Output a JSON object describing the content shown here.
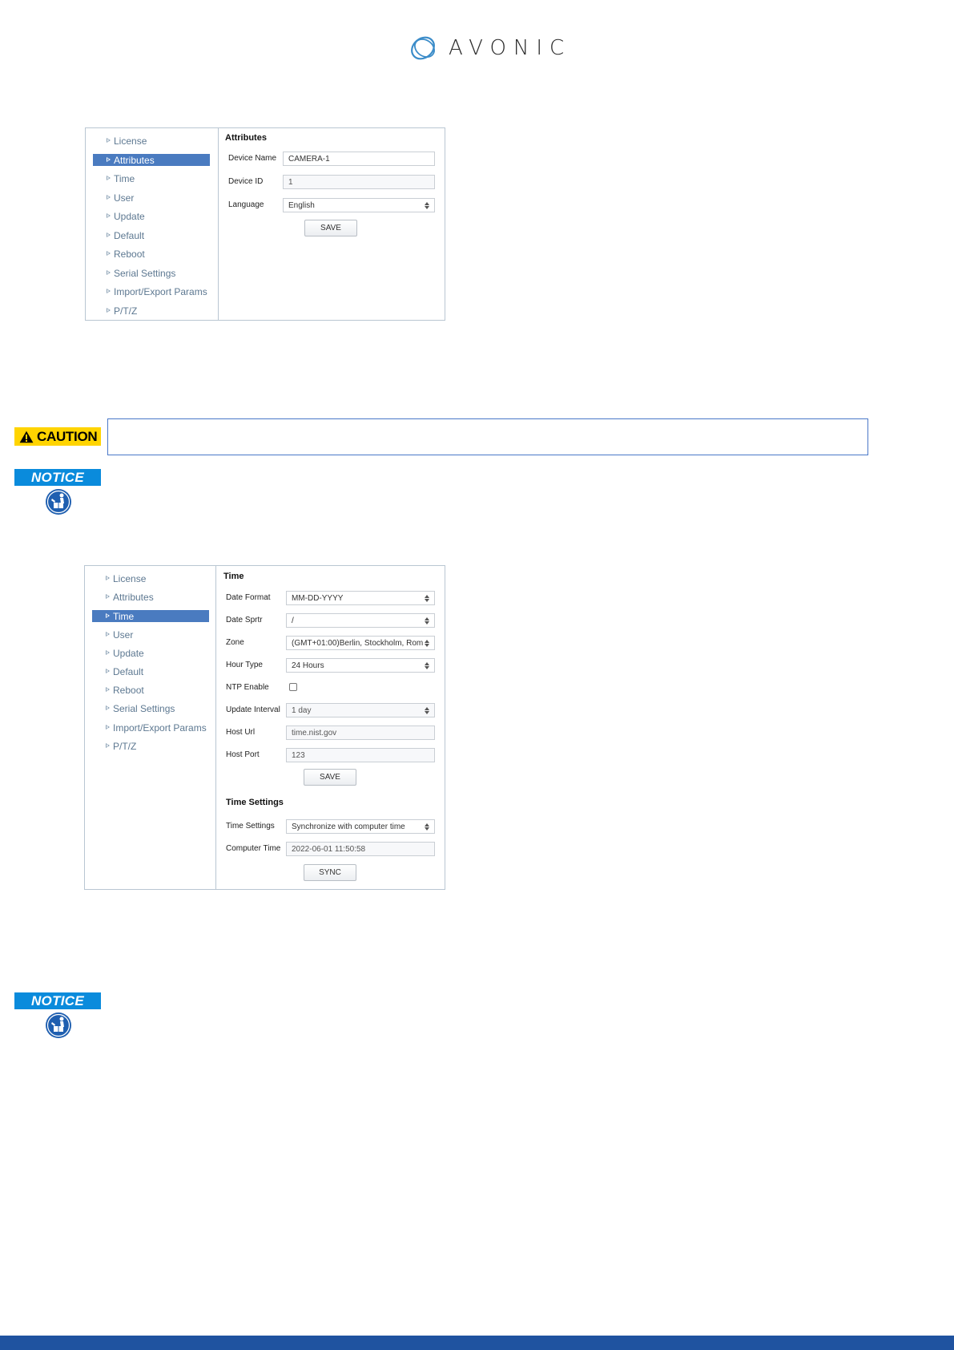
{
  "brand": {
    "name": "AVONIC"
  },
  "panel1": {
    "nav": [
      "License",
      "Attributes",
      "Time",
      "User",
      "Update",
      "Default",
      "Reboot",
      "Serial Settings",
      "Import/Export Params",
      "P/T/Z"
    ],
    "active": "Attributes",
    "title": "Attributes",
    "fields": {
      "device_name": {
        "label": "Device Name",
        "value": "CAMERA-1"
      },
      "device_id": {
        "label": "Device ID",
        "value": "1"
      },
      "language": {
        "label": "Language",
        "value": "English"
      }
    },
    "save_label": "SAVE"
  },
  "caution": {
    "label": "CAUTION",
    "text": ""
  },
  "notice1": {
    "label": "NOTICE"
  },
  "panel2": {
    "nav": [
      "License",
      "Attributes",
      "Time",
      "User",
      "Update",
      "Default",
      "Reboot",
      "Serial Settings",
      "Import/Export Params",
      "P/T/Z"
    ],
    "active": "Time",
    "title": "Time",
    "fields": {
      "date_format": {
        "label": "Date Format",
        "value": "MM-DD-YYYY"
      },
      "date_sprtr": {
        "label": "Date Sprtr",
        "value": "/"
      },
      "zone": {
        "label": "Zone",
        "value": "(GMT+01:00)Berlin, Stockholm, Rom"
      },
      "hour_type": {
        "label": "Hour Type",
        "value": "24 Hours"
      },
      "ntp_enable": {
        "label": "NTP Enable",
        "checked": false
      },
      "update_interval": {
        "label": "Update Interval",
        "value": "1 day"
      },
      "host_url": {
        "label": "Host Url",
        "value": "time.nist.gov"
      },
      "host_port": {
        "label": "Host Port",
        "value": "123"
      }
    },
    "save_label": "SAVE",
    "time_settings_title": "Time Settings",
    "time_settings": {
      "label": "Time Settings",
      "value": "Synchronize with computer time"
    },
    "computer_time": {
      "label": "Computer Time",
      "value": "2022-06-01 11:50:58"
    },
    "sync_label": "SYNC"
  },
  "notice2": {
    "label": "NOTICE"
  },
  "colors": {
    "accent": "#4a7bc0",
    "caution": "#ffd400",
    "notice": "#0a8bdc",
    "footer": "#1f53a0"
  },
  "icons": {
    "caution": "warning-triangle-icon",
    "notice": "hand-book-icon",
    "nav": "triangle-right-icon"
  }
}
